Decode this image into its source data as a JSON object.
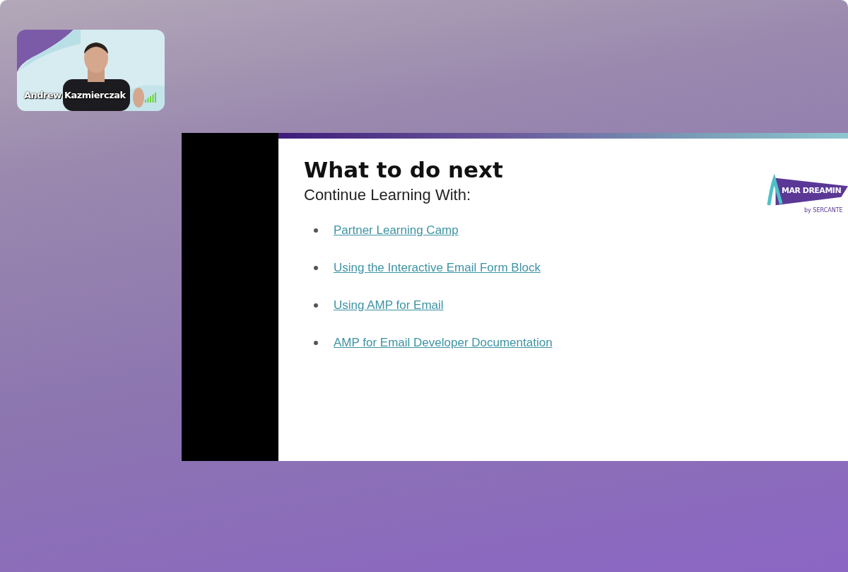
{
  "speaker_tile": {
    "kind": "picture",
    "name": "Andrew Kazmierczak"
  },
  "slide": {
    "title": "What to do next",
    "subtitle": "Continue Learning With:",
    "links": [
      "Partner Learning Camp",
      "Using the Interactive Email Form Block",
      "Using AMP for Email",
      "AMP for Email Developer Documentation"
    ],
    "logo": {
      "wordmark": "MAR DREAMIN",
      "byline": "by SERCANTE"
    }
  }
}
